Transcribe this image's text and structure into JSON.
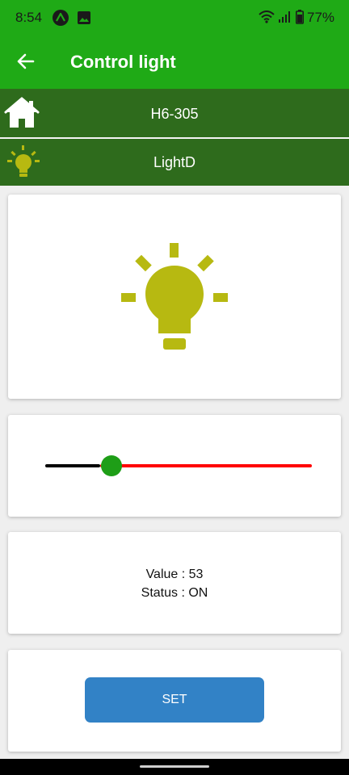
{
  "status_bar": {
    "time": "8:54",
    "battery": "77%"
  },
  "app_bar": {
    "title": "Control light"
  },
  "home_row": {
    "label": "H6-305"
  },
  "light_row": {
    "label": "LightD"
  },
  "slider": {
    "fraction": 0.23
  },
  "info": {
    "value_text": "Value : 53",
    "status_text": "Status : ON"
  },
  "set_button": {
    "label": "SET"
  },
  "colors": {
    "primary_green": "#1faa16",
    "row_green": "#2e6b1c",
    "bulb_yellow": "#b7b911",
    "slider_thumb": "#1e9e17",
    "slider_right": "#ff0000",
    "button_blue": "#3282c6"
  },
  "icons": {
    "back": "arrow-back-icon",
    "home": "home-icon",
    "bulb": "light-bulb-icon"
  }
}
